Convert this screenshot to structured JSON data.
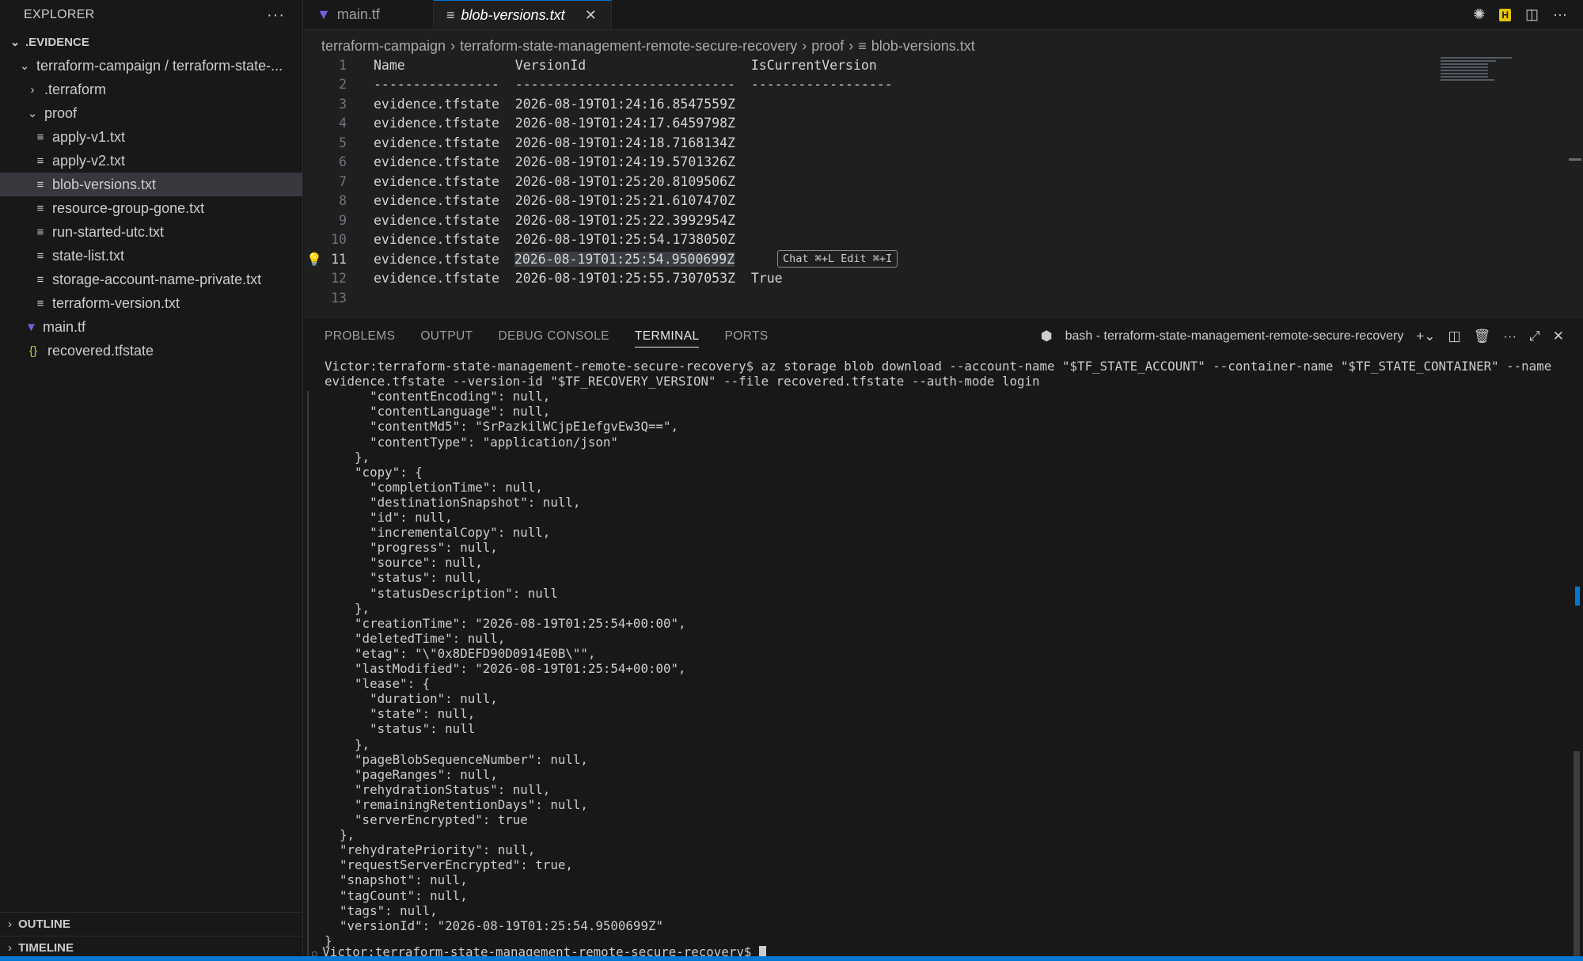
{
  "sidebar": {
    "title": "EXPLORER",
    "more": "···",
    "root": ".EVIDENCE",
    "tree": [
      {
        "label": "terraform-campaign / terraform-state-...",
        "indent": 1,
        "type": "folder-open"
      },
      {
        "label": ".terraform",
        "indent": 2,
        "type": "folder-closed"
      },
      {
        "label": "proof",
        "indent": 2,
        "type": "folder-open"
      },
      {
        "label": "apply-v1.txt",
        "indent": 3,
        "type": "txt"
      },
      {
        "label": "apply-v2.txt",
        "indent": 3,
        "type": "txt"
      },
      {
        "label": "blob-versions.txt",
        "indent": 3,
        "type": "txt",
        "selected": true
      },
      {
        "label": "resource-group-gone.txt",
        "indent": 3,
        "type": "txt"
      },
      {
        "label": "run-started-utc.txt",
        "indent": 3,
        "type": "txt"
      },
      {
        "label": "state-list.txt",
        "indent": 3,
        "type": "txt"
      },
      {
        "label": "storage-account-name-private.txt",
        "indent": 3,
        "type": "txt"
      },
      {
        "label": "terraform-version.txt",
        "indent": 3,
        "type": "txt"
      },
      {
        "label": "main.tf",
        "indent": 2,
        "type": "tf"
      },
      {
        "label": "recovered.tfstate",
        "indent": 2,
        "type": "json"
      }
    ],
    "outline": "OUTLINE",
    "timeline": "TIMELINE"
  },
  "tabs": [
    {
      "label": "main.tf",
      "active": false
    },
    {
      "label": "blob-versions.txt",
      "active": true
    }
  ],
  "breadcrumbs": [
    "terraform-campaign",
    "terraform-state-management-remote-secure-recovery",
    "proof",
    "blob-versions.txt"
  ],
  "editor": {
    "lines": [
      "Name              VersionId                     IsCurrentVersion",
      "----------------  ----------------------------  ------------------",
      "evidence.tfstate  2026-08-19T01:24:16.8547559Z",
      "evidence.tfstate  2026-08-19T01:24:17.6459798Z",
      "evidence.tfstate  2026-08-19T01:24:18.7168134Z",
      "evidence.tfstate  2026-08-19T01:24:19.5701326Z",
      "evidence.tfstate  2026-08-19T01:25:20.8109506Z",
      "evidence.tfstate  2026-08-19T01:25:21.6107470Z",
      "evidence.tfstate  2026-08-19T01:25:22.3992954Z",
      "evidence.tfstate  2026-08-19T01:25:54.1738050Z",
      "evidence.tfstate  ",
      "evidence.tfstate  2026-08-19T01:25:55.7307053Z  True",
      ""
    ],
    "line_numbers": [
      "1",
      "2",
      "3",
      "4",
      "5",
      "6",
      "7",
      "8",
      "9",
      "10",
      "11",
      "12",
      "13"
    ],
    "selected_text": "2026-08-19T01:25:54.9500699Z",
    "current_line": 11,
    "inline_hint": "Chat ⌘+L Edit ⌘+I"
  },
  "panel": {
    "tabs": [
      "PROBLEMS",
      "OUTPUT",
      "DEBUG CONSOLE",
      "TERMINAL",
      "PORTS"
    ],
    "active_tab": "TERMINAL",
    "terminal_name": "bash - terraform-state-management-remote-secure-recovery"
  },
  "terminal": {
    "lines": [
      "Victor:terraform-state-management-remote-secure-recovery$ az storage blob download --account-name \"$TF_STATE_ACCOUNT\" --container-name \"$TF_STATE_CONTAINER\" --name",
      "evidence.tfstate --version-id \"$TF_RECOVERY_VERSION\" --file recovered.tfstate --auth-mode login",
      "      \"contentEncoding\": null,",
      "      \"contentLanguage\": null,",
      "      \"contentMd5\": \"SrPazkilWCjpE1efgvEw3Q==\",",
      "      \"contentType\": \"application/json\"",
      "    },",
      "    \"copy\": {",
      "      \"completionTime\": null,",
      "      \"destinationSnapshot\": null,",
      "      \"id\": null,",
      "      \"incrementalCopy\": null,",
      "      \"progress\": null,",
      "      \"source\": null,",
      "      \"status\": null,",
      "      \"statusDescription\": null",
      "    },",
      "    \"creationTime\": \"2026-08-19T01:25:54+00:00\",",
      "    \"deletedTime\": null,",
      "    \"etag\": \"\\\"0x8DEFD90D0914E0B\\\"\",",
      "    \"lastModified\": \"2026-08-19T01:25:54+00:00\",",
      "    \"lease\": {",
      "      \"duration\": null,",
      "      \"state\": null,",
      "      \"status\": null",
      "    },",
      "    \"pageBlobSequenceNumber\": null,",
      "    \"pageRanges\": null,",
      "    \"rehydrationStatus\": null,",
      "    \"remainingRetentionDays\": null,",
      "    \"serverEncrypted\": true",
      "  },",
      "  \"rehydratePriority\": null,",
      "  \"requestServerEncrypted\": true,",
      "  \"snapshot\": null,",
      "  \"tagCount\": null,",
      "  \"tags\": null,",
      "  \"versionId\": \"2026-08-19T01:25:54.9500699Z\"",
      "}"
    ],
    "prompt": "Victor:terraform-state-management-remote-secure-recovery$ "
  },
  "colors": {
    "accent": "#0078d4",
    "terraform": "#7b5de0",
    "json": "#cbcb41"
  }
}
